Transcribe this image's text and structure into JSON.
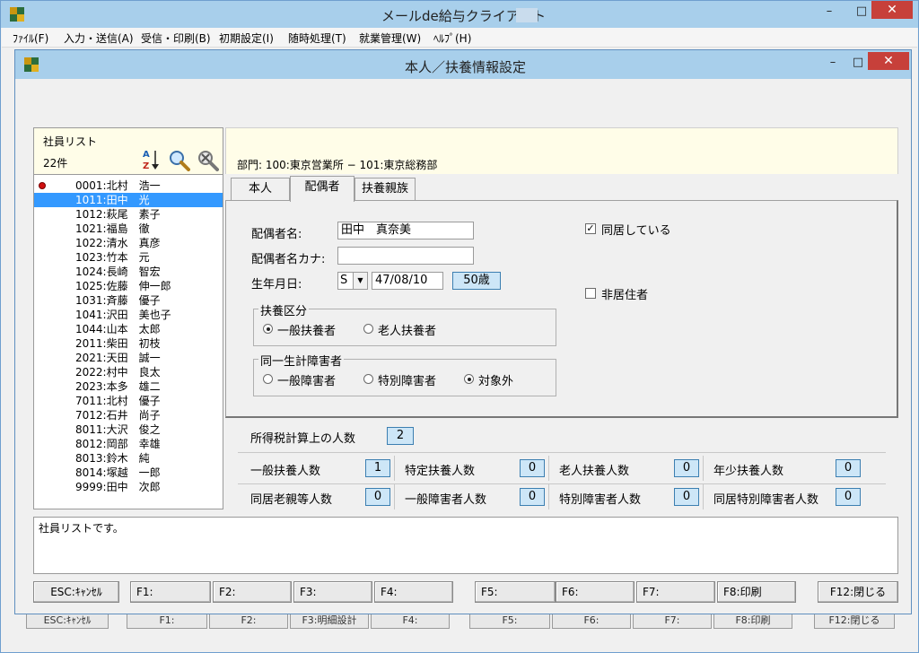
{
  "main_window": {
    "title": "メールde給与クライアント",
    "minimize": "–",
    "maximize": "□",
    "close": "✕"
  },
  "menu": [
    "ﾌｧｲﾙ(F)",
    "入力・送信(A)",
    "受信・印刷(B)",
    "初期設定(I)",
    "随時処理(T)",
    "就業管理(W)",
    "ﾍﾙﾌﾟ(H)"
  ],
  "ghost_buttons": [
    "ESC:ｷｬﾝｾﾙ",
    "F1:",
    "F2:",
    "F3:明細設計",
    "F4:",
    "F5:",
    "F6:",
    "F7:",
    "F8:印刷",
    "F12:閉じる"
  ],
  "dialog": {
    "title": "本人／扶養情報設定",
    "minimize": "–",
    "maximize": "□",
    "close": "✕"
  },
  "employee_list": {
    "header": "社員リスト",
    "count": "22件",
    "selected_index": 1,
    "marked_index": 0,
    "items": [
      "0001:北村　浩一",
      "1011:田中　光",
      "1012:萩尾　素子",
      "1021:福島　徹",
      "1022:清水　真彦",
      "1023:竹本　元",
      "1024:長崎　智宏",
      "1025:佐藤　伸一郎",
      "1031:斉藤　優子",
      "1041:沢田　美也子",
      "1044:山本　太郎",
      "2011:柴田　初枝",
      "2021:天田　誠一",
      "2022:村中　良太",
      "2023:本多　雄二",
      "7011:北村　優子",
      "7012:石井　尚子",
      "8011:大沢　俊之",
      "8012:岡部　幸雄",
      "8013:鈴木　純",
      "8014:塚越　一郎",
      "9999:田中　次郎"
    ]
  },
  "department": "部門:  100:東京営業所 − 101:東京総務部",
  "tabs": [
    "本人",
    "配偶者",
    "扶養親族"
  ],
  "active_tab": 1,
  "spouse": {
    "name_label": "配偶者名:",
    "name_value": "田中　真奈美",
    "kana_label": "配偶者名カナ:",
    "kana_value": "",
    "birth_label": "生年月日:",
    "era_value": "S",
    "birth_value": "47/08/10",
    "age": "50歳",
    "cohabit_label": "同居している",
    "cohabit_checked": true,
    "nonresident_label": "非居住者",
    "nonresident_checked": false,
    "dependent_group": {
      "title": "扶養区分",
      "options": [
        "一般扶養者",
        "老人扶養者"
      ],
      "selected": 0
    },
    "disability_group": {
      "title": "同一生計障害者",
      "options": [
        "一般障害者",
        "特別障害者",
        "対象外"
      ],
      "selected": 2
    }
  },
  "counts": {
    "tax_count_label": "所得税計算上の人数",
    "tax_count_value": "2",
    "cells": [
      {
        "label": "一般扶養人数",
        "value": "1"
      },
      {
        "label": "特定扶養人数",
        "value": "0"
      },
      {
        "label": "老人扶養人数",
        "value": "0"
      },
      {
        "label": "年少扶養人数",
        "value": "0"
      },
      {
        "label": "同居老親等人数",
        "value": "0"
      },
      {
        "label": "一般障害者人数",
        "value": "0"
      },
      {
        "label": "特別障害者人数",
        "value": "0"
      },
      {
        "label": "同居特別障害者人数",
        "value": "0"
      }
    ]
  },
  "message": "社員リストです。",
  "function_keys": [
    "ESC:ｷｬﾝｾﾙ",
    "F1:",
    "F2:",
    "F3:",
    "F4:",
    "F5:",
    "F6:",
    "F7:",
    "F8:印刷",
    "F12:閉じる"
  ]
}
